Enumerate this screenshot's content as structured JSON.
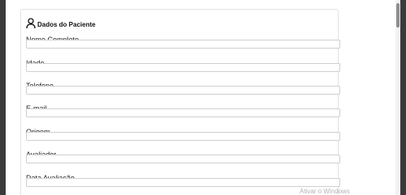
{
  "card": {
    "title": "Dados do Paciente",
    "icon": "user-icon"
  },
  "fields": [
    {
      "label": "Nome Completo",
      "value": "",
      "placeholder": ""
    },
    {
      "label": "Idade",
      "value": "",
      "placeholder": ""
    },
    {
      "label": "Telefone",
      "value": "",
      "placeholder": ""
    },
    {
      "label": "E-mail",
      "value": "",
      "placeholder": ""
    },
    {
      "label": "Origem",
      "value": "",
      "placeholder": ""
    },
    {
      "label": "Avaliador",
      "value": "",
      "placeholder": ""
    },
    {
      "label": "Data Avaliação",
      "value": "",
      "placeholder": ""
    }
  ],
  "watermark": "Ativar o Windows"
}
